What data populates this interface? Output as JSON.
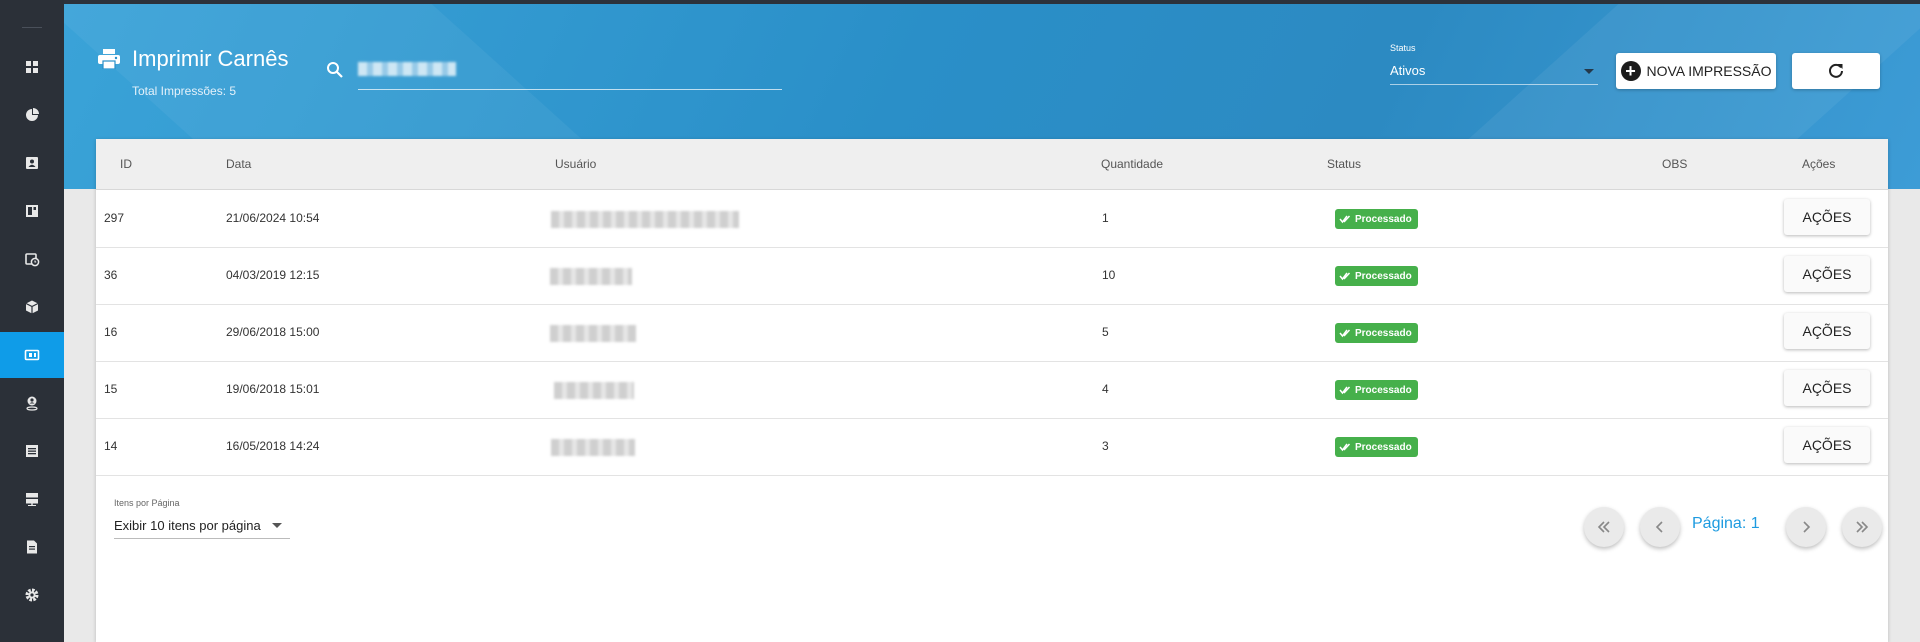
{
  "header": {
    "title": "Imprimir Carnês",
    "total_label": "Total Impressões: 5",
    "status_label": "Status",
    "status_value": "Ativos",
    "new_button": "NOVA IMPRESSÃO"
  },
  "sidebar": {
    "items": [
      {
        "icon": "dashboard-icon"
      },
      {
        "icon": "pie-chart-icon"
      },
      {
        "icon": "contact-card-icon"
      },
      {
        "icon": "layout-icon"
      },
      {
        "icon": "calendar-clock-icon"
      },
      {
        "icon": "package-icon"
      },
      {
        "icon": "carne-icon",
        "active": true
      },
      {
        "icon": "location-person-icon"
      },
      {
        "icon": "list-icon"
      },
      {
        "icon": "server-icon"
      },
      {
        "icon": "document-icon"
      },
      {
        "icon": "settings-icon"
      }
    ]
  },
  "table": {
    "columns": [
      "ID",
      "Data",
      "Usuário",
      "Quantidade",
      "Status",
      "OBS",
      "Ações"
    ],
    "rows": [
      {
        "id": "297",
        "date": "21/06/2024 10:54",
        "quantity": "1",
        "status": "Processado",
        "action": "AÇÕES"
      },
      {
        "id": "36",
        "date": "04/03/2019 12:15",
        "quantity": "10",
        "status": "Processado",
        "action": "AÇÕES"
      },
      {
        "id": "16",
        "date": "29/06/2018 15:00",
        "quantity": "5",
        "status": "Processado",
        "action": "AÇÕES"
      },
      {
        "id": "15",
        "date": "19/06/2018 15:01",
        "quantity": "4",
        "status": "Processado",
        "action": "AÇÕES"
      },
      {
        "id": "14",
        "date": "16/05/2018 14:24",
        "quantity": "3",
        "status": "Processado",
        "action": "AÇÕES"
      }
    ]
  },
  "pagination": {
    "per_page_label": "Itens por Página",
    "per_page_value": "Exibir 10 itens por página",
    "page_label": "Página: 1"
  },
  "colors": {
    "header": "#2a8fc8",
    "sidebar": "#2b3038",
    "active": "#0f9ce8",
    "badge": "#46b04b",
    "page_link": "#1e9be0"
  }
}
